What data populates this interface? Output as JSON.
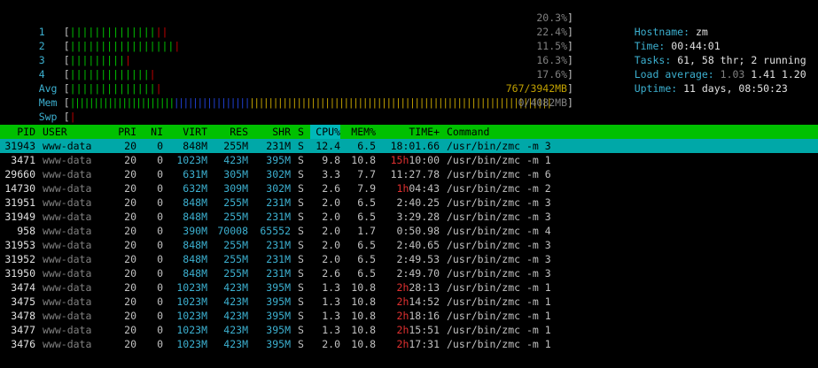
{
  "cpus": [
    {
      "label": "1",
      "green": "||||||||||||||",
      "red": "||",
      "pct": "20.3%"
    },
    {
      "label": "2",
      "green": "|||||||||||||||||",
      "red": "|",
      "pct": "22.4%"
    },
    {
      "label": "3",
      "green": "|||||||||",
      "red": "|",
      "pct": "11.5%"
    },
    {
      "label": "4",
      "green": "|||||||||||||",
      "red": "|",
      "pct": "16.3%"
    },
    {
      "label": "Avg",
      "green": "||||||||||||||",
      "red": "|",
      "pct": "17.6%"
    }
  ],
  "mem": {
    "label": "Mem",
    "green": "||||||||||||||||||||||",
    "blue": "||||||||||||||||",
    "yellow": "||||||||||||||||||||||||||||||||||||||||||||||||||||||||||||||||",
    "value": "767/3942MB"
  },
  "swp": {
    "label": "Swp",
    "red": "|",
    "value": "0/4082MB"
  },
  "info": {
    "hostname_label": "Hostname:",
    "hostname": "zm",
    "time_label": "Time:",
    "time": "00:44:01",
    "tasks_label": "Tasks:",
    "tasks_procs": "61,",
    "tasks_thr": "58 thr;",
    "tasks_running": "2 running",
    "load_label": "Load average:",
    "load1": "1.03",
    "load5": "1.41",
    "load15": "1.20",
    "uptime_label": "Uptime:",
    "uptime": "11 days, 08:50:23"
  },
  "columns": {
    "pid": "PID",
    "user": "USER",
    "pri": "PRI",
    "ni": "NI",
    "virt": "VIRT",
    "res": "RES",
    "shr": "SHR",
    "s": "S",
    "cpu": "CPU%",
    "mem": "MEM%",
    "time": "TIME+",
    "cmd": "Command"
  },
  "processes": [
    {
      "pid": "31943",
      "user": "www-data",
      "pri": "20",
      "ni": "0",
      "virt": "848M",
      "res": "255M",
      "shr": "231M",
      "s": "S",
      "cpu": "12.4",
      "mem": "6.5",
      "time_h": "",
      "time": "18:01.66",
      "cmd": "/usr/bin/zmc -m 3"
    },
    {
      "pid": "3471",
      "user": "www-data",
      "pri": "20",
      "ni": "0",
      "virt": "1023M",
      "res": "423M",
      "shr": "395M",
      "s": "S",
      "cpu": "9.8",
      "mem": "10.8",
      "time_h": "15h",
      "time": "10:00",
      "cmd": "/usr/bin/zmc -m 1"
    },
    {
      "pid": "29660",
      "user": "www-data",
      "pri": "20",
      "ni": "0",
      "virt": "631M",
      "res": "305M",
      "shr": "302M",
      "s": "S",
      "cpu": "3.3",
      "mem": "7.7",
      "time_h": "",
      "time": "11:27.78",
      "cmd": "/usr/bin/zmc -m 6"
    },
    {
      "pid": "14730",
      "user": "www-data",
      "pri": "20",
      "ni": "0",
      "virt": "632M",
      "res": "309M",
      "shr": "302M",
      "s": "S",
      "cpu": "2.6",
      "mem": "7.9",
      "time_h": "1h",
      "time": "04:43",
      "cmd": "/usr/bin/zmc -m 2"
    },
    {
      "pid": "31951",
      "user": "www-data",
      "pri": "20",
      "ni": "0",
      "virt": "848M",
      "res": "255M",
      "shr": "231M",
      "s": "S",
      "cpu": "2.0",
      "mem": "6.5",
      "time_h": "",
      "time": "2:40.25",
      "cmd": "/usr/bin/zmc -m 3"
    },
    {
      "pid": "31949",
      "user": "www-data",
      "pri": "20",
      "ni": "0",
      "virt": "848M",
      "res": "255M",
      "shr": "231M",
      "s": "S",
      "cpu": "2.0",
      "mem": "6.5",
      "time_h": "",
      "time": "3:29.28",
      "cmd": "/usr/bin/zmc -m 3"
    },
    {
      "pid": "958",
      "user": "www-data",
      "pri": "20",
      "ni": "0",
      "virt": "390M",
      "res": "70008",
      "shr": "65552",
      "s": "S",
      "cpu": "2.0",
      "mem": "1.7",
      "time_h": "",
      "time": "0:50.98",
      "cmd": "/usr/bin/zmc -m 4"
    },
    {
      "pid": "31953",
      "user": "www-data",
      "pri": "20",
      "ni": "0",
      "virt": "848M",
      "res": "255M",
      "shr": "231M",
      "s": "S",
      "cpu": "2.0",
      "mem": "6.5",
      "time_h": "",
      "time": "2:40.65",
      "cmd": "/usr/bin/zmc -m 3"
    },
    {
      "pid": "31952",
      "user": "www-data",
      "pri": "20",
      "ni": "0",
      "virt": "848M",
      "res": "255M",
      "shr": "231M",
      "s": "S",
      "cpu": "2.0",
      "mem": "6.5",
      "time_h": "",
      "time": "2:49.53",
      "cmd": "/usr/bin/zmc -m 3"
    },
    {
      "pid": "31950",
      "user": "www-data",
      "pri": "20",
      "ni": "0",
      "virt": "848M",
      "res": "255M",
      "shr": "231M",
      "s": "S",
      "cpu": "2.6",
      "mem": "6.5",
      "time_h": "",
      "time": "2:49.70",
      "cmd": "/usr/bin/zmc -m 3"
    },
    {
      "pid": "3474",
      "user": "www-data",
      "pri": "20",
      "ni": "0",
      "virt": "1023M",
      "res": "423M",
      "shr": "395M",
      "s": "S",
      "cpu": "1.3",
      "mem": "10.8",
      "time_h": "2h",
      "time": "28:13",
      "cmd": "/usr/bin/zmc -m 1"
    },
    {
      "pid": "3475",
      "user": "www-data",
      "pri": "20",
      "ni": "0",
      "virt": "1023M",
      "res": "423M",
      "shr": "395M",
      "s": "S",
      "cpu": "1.3",
      "mem": "10.8",
      "time_h": "2h",
      "time": "14:52",
      "cmd": "/usr/bin/zmc -m 1"
    },
    {
      "pid": "3478",
      "user": "www-data",
      "pri": "20",
      "ni": "0",
      "virt": "1023M",
      "res": "423M",
      "shr": "395M",
      "s": "S",
      "cpu": "1.3",
      "mem": "10.8",
      "time_h": "2h",
      "time": "18:16",
      "cmd": "/usr/bin/zmc -m 1"
    },
    {
      "pid": "3477",
      "user": "www-data",
      "pri": "20",
      "ni": "0",
      "virt": "1023M",
      "res": "423M",
      "shr": "395M",
      "s": "S",
      "cpu": "1.3",
      "mem": "10.8",
      "time_h": "2h",
      "time": "15:51",
      "cmd": "/usr/bin/zmc -m 1"
    },
    {
      "pid": "3476",
      "user": "www-data",
      "pri": "20",
      "ni": "0",
      "virt": "1023M",
      "res": "423M",
      "shr": "395M",
      "s": "S",
      "cpu": "2.0",
      "mem": "10.8",
      "time_h": "2h",
      "time": "17:31",
      "cmd": "/usr/bin/zmc -m 1"
    }
  ],
  "colors": {
    "header_bg": "#00c000",
    "selected_bg": "#00a8a8",
    "label": "#3cb0d0",
    "bar_green": "#00c000",
    "bar_red": "#c00000",
    "bar_blue": "#2040d0",
    "bar_yellow": "#c0a000",
    "hours": "#e03030"
  }
}
